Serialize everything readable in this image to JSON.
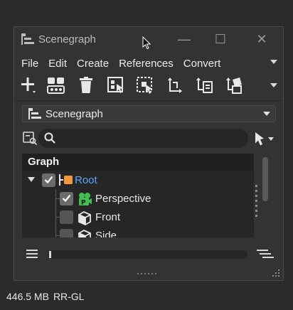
{
  "window": {
    "title": "Scenegraph",
    "minimize_label": "—",
    "maximize_label": "☐",
    "close_label": "✕"
  },
  "menu": {
    "items": [
      "File",
      "Edit",
      "Create",
      "References",
      "Convert"
    ]
  },
  "toolbar": {
    "icons": [
      "add-icon",
      "group-icon",
      "delete-icon",
      "select-children-icon",
      "select-hierarchy-icon",
      "transform-axes-icon",
      "reference-icon",
      "convert-icon"
    ]
  },
  "dropdown": {
    "label": "Scenegraph"
  },
  "search": {
    "value": "",
    "placeholder": ""
  },
  "graph": {
    "header": "Graph",
    "nodes": [
      {
        "label": "Root",
        "checked": true,
        "expanded": true
      },
      {
        "label": "Perspective",
        "checked": true
      },
      {
        "label": "Front",
        "checked": false
      },
      {
        "label": "Side",
        "checked": false
      }
    ]
  },
  "status": {
    "memory": "446.5 MB",
    "renderer": "RR-GL"
  },
  "colors": {
    "root_label": "#5aa6ff",
    "camera_green": "#3fbf4f",
    "root_orange": "#f29a3a"
  }
}
